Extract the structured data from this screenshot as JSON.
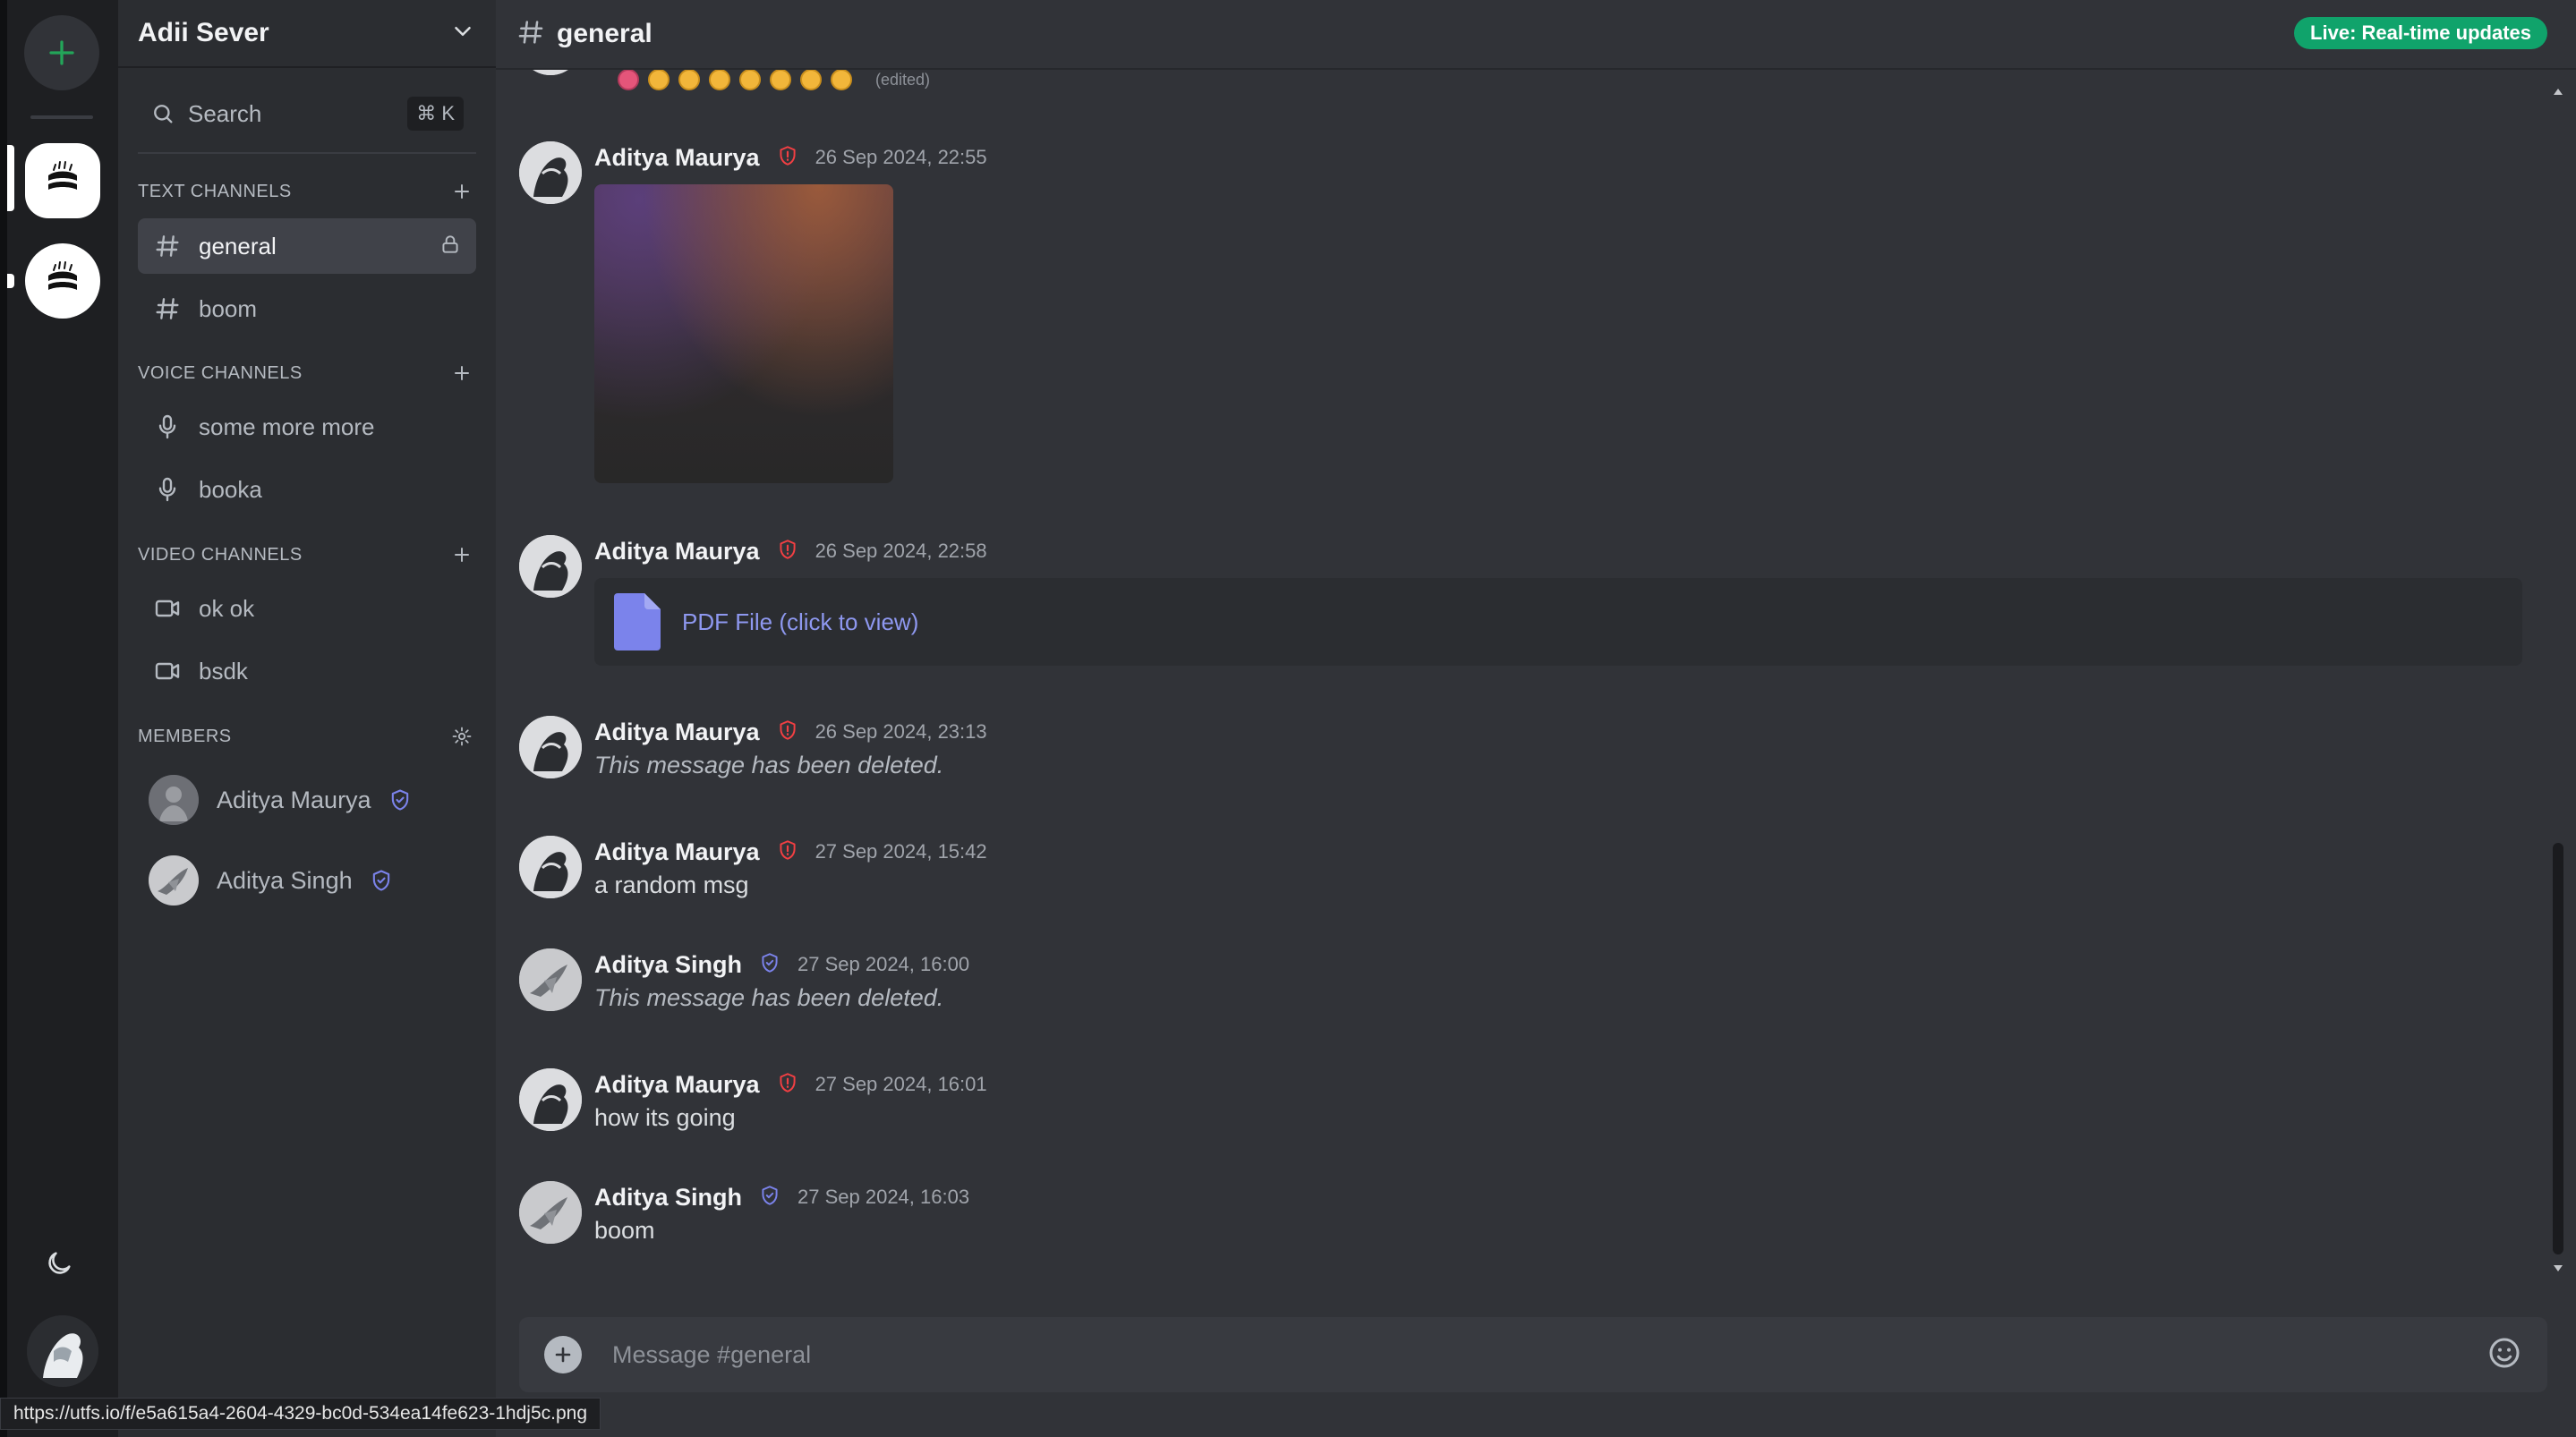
{
  "server": {
    "name": "Adii Sever"
  },
  "search": {
    "label": "Search",
    "shortcut": "⌘ K"
  },
  "sections": {
    "text": "TEXT CHANNELS",
    "voice": "VOICE CHANNELS",
    "video": "VIDEO CHANNELS",
    "members": "MEMBERS"
  },
  "text_channels": [
    {
      "name": "general",
      "active": true,
      "locked": true
    },
    {
      "name": "boom",
      "active": false,
      "locked": false
    }
  ],
  "voice_channels": [
    {
      "name": "some more more"
    },
    {
      "name": "booka"
    }
  ],
  "video_channels": [
    {
      "name": "ok ok"
    },
    {
      "name": "bsdk"
    }
  ],
  "members": [
    {
      "name": "Aditya Maurya"
    },
    {
      "name": "Aditya Singh"
    }
  ],
  "channel_header": {
    "title": "general",
    "live_badge": "Live: Real-time updates"
  },
  "messages": [
    {
      "author": "Aditya Maurya",
      "role": "admin",
      "time": "26 Sep 2024, 22:55",
      "type": "image"
    },
    {
      "author": "Aditya Maurya",
      "role": "admin",
      "time": "26 Sep 2024, 22:58",
      "type": "pdf",
      "text": "PDF File (click to view)"
    },
    {
      "author": "Aditya Maurya",
      "role": "admin",
      "time": "26 Sep 2024, 23:13",
      "type": "deleted",
      "text": "This message has been deleted."
    },
    {
      "author": "Aditya Maurya",
      "role": "admin",
      "time": "27 Sep 2024, 15:42",
      "type": "text",
      "text": "a random msg"
    },
    {
      "author": "Aditya Singh",
      "role": "moderator",
      "time": "27 Sep 2024, 16:00",
      "type": "deleted",
      "text": "This message has been deleted."
    },
    {
      "author": "Aditya Maurya",
      "role": "admin",
      "time": "27 Sep 2024, 16:01",
      "type": "text",
      "text": "how its going"
    },
    {
      "author": "Aditya Singh",
      "role": "moderator",
      "time": "27 Sep 2024, 16:03",
      "type": "text",
      "text": "boom"
    }
  ],
  "edited_label": "(edited)",
  "composer": {
    "placeholder": "Message #general"
  },
  "status_url": "https://utfs.io/f/e5a615a4-2604-4329-bc0d-534ea14fe623-1hdj5c.png",
  "colors": {
    "admin_badge": "#f23f43",
    "moderator_badge": "#7b83eb",
    "live_badge": "#10a36b",
    "link": "#8e98f0",
    "add_server": "#23a559"
  },
  "icons": {
    "add_server": "plus-icon",
    "theme": "moon-icon",
    "search": "search-icon",
    "text_channel": "hash-icon",
    "voice_channel": "microphone-icon",
    "video_channel": "video-icon",
    "lock": "lock-icon",
    "settings": "gear-icon",
    "admin": "shield-alert-icon",
    "moderator": "shield-check-icon",
    "file": "file-icon",
    "emoji": "smile-icon"
  }
}
